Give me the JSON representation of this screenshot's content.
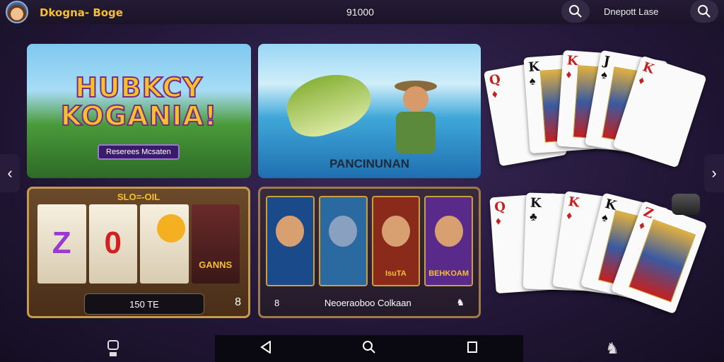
{
  "header": {
    "brand": "Dkogna- Boge",
    "balance": "91000",
    "deposit": "Dnepott Lase",
    "icons": [
      "avatar",
      "search-icon",
      "search-icon"
    ]
  },
  "tiles": {
    "tile1_logo_line1": "HUBKCY",
    "tile1_logo_line2": "KOGANIA!",
    "tile1_subtitle": "Reserees Mcsaten",
    "tile2_caption": "PANCINUNAN"
  },
  "slots": {
    "slot1_title": "SLO=-OIL",
    "reel_symbols": [
      "Z",
      "0",
      "",
      ""
    ],
    "slot1_label": "GANNS",
    "slot1_amount": "150 TE",
    "slot1_count": "8",
    "slot2_labels": [
      "",
      "",
      "IsuTA",
      "BEHKOAM"
    ],
    "slot2_count": "8",
    "slot2_caption": "Neoeraoboo Colkaan"
  },
  "cards": {
    "top_row": [
      "Q",
      "K",
      "K",
      "J",
      "K"
    ],
    "bottom_row": [
      "Q",
      "K",
      "K",
      "K",
      "Z"
    ]
  },
  "navbar": {
    "icons": [
      "back-icon",
      "search-icon",
      "square-icon"
    ]
  }
}
